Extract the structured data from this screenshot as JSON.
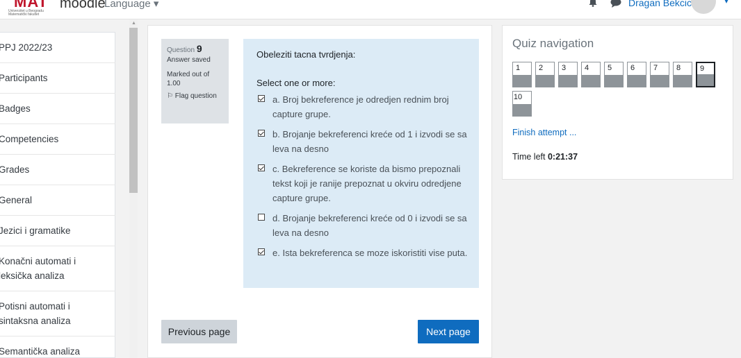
{
  "header": {
    "logo_text": "MAT",
    "logo_subtitle": "Univerzitet u Beogradu Matematički fakultet",
    "brand": "moodle",
    "language_label": "Language ▾",
    "user_name": "Dragan Bekcic",
    "user_caret": "▾"
  },
  "sidebar": {
    "items": [
      {
        "label": "PPJ 2022/23"
      },
      {
        "label": "Participants"
      },
      {
        "label": "Badges"
      },
      {
        "label": "Competencies"
      },
      {
        "label": "Grades"
      },
      {
        "label": "General"
      },
      {
        "label": "Jezici i gramatike"
      },
      {
        "label": "Konačni automati i leksička analiza"
      },
      {
        "label": "Potisni automati i sintaksna analiza"
      },
      {
        "label": "Semantička analiza"
      }
    ]
  },
  "question": {
    "number_prefix": "Question",
    "number": "9",
    "state": "Answer saved",
    "grade": "Marked out of 1.00",
    "flag_label": "Flag question",
    "text": "Obeleziti tacna tvrdjenja:",
    "prompt": "Select one or more:",
    "answers": [
      {
        "text": "a. Broj bekreference je odredjen rednim broj capture grupe.",
        "checked": true
      },
      {
        "text": "b. Brojanje bekreferenci kreće od 1 i izvodi se sa leva na desno",
        "checked": true
      },
      {
        "text": "c. Bekreference se koriste da bismo prepoznali tekst koji je ranije prepoznat u okviru odredjene capture grupe.",
        "checked": true
      },
      {
        "text": "d. Brojanje bekreferenci kreće od 0 i izvodi se sa leva na desno",
        "checked": false
      },
      {
        "text": "e. Ista bekreferenca se moze iskoristiti vise puta.",
        "checked": true
      }
    ]
  },
  "buttons": {
    "previous": "Previous page",
    "next": "Next page"
  },
  "quiz_nav": {
    "title": "Quiz navigation",
    "questions": [
      "1",
      "2",
      "3",
      "4",
      "5",
      "6",
      "7",
      "8",
      "9",
      "10"
    ],
    "current": "9",
    "finish": "Finish attempt ...",
    "time_label": "Time left",
    "time_value": "0:21:37"
  },
  "colors": {
    "accent": "#0f6cbf",
    "formulation_bg": "#dcebf6",
    "info_bg": "#dee2e6",
    "logo_red": "#c0162c"
  }
}
